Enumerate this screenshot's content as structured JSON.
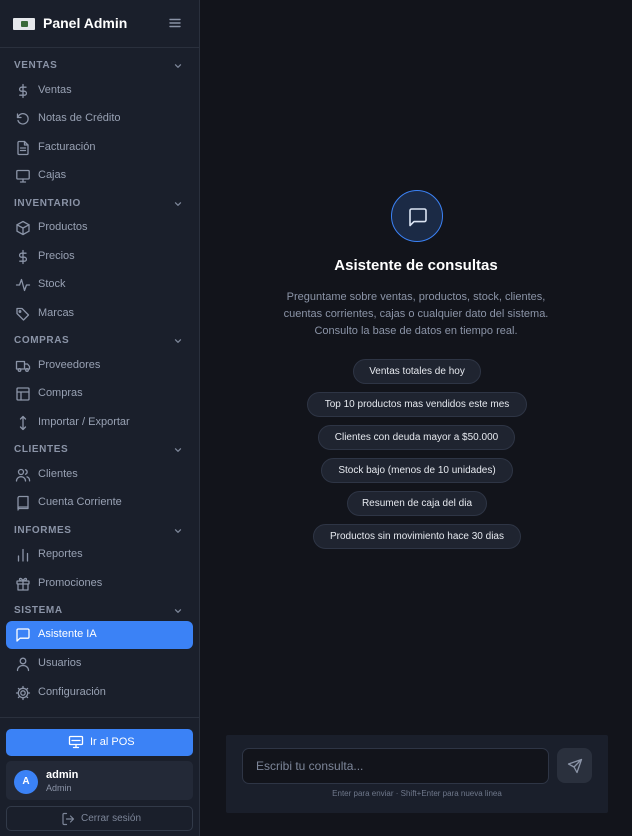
{
  "app": {
    "title": "Panel Admin"
  },
  "sidebar": {
    "sections": [
      {
        "title": "VENTAS",
        "items": [
          {
            "label": "Ventas",
            "icon": "dollar-icon"
          },
          {
            "label": "Notas de Crédito",
            "icon": "rotate-ccw-icon"
          },
          {
            "label": "Facturación",
            "icon": "file-text-icon"
          },
          {
            "label": "Cajas",
            "icon": "monitor-icon"
          }
        ]
      },
      {
        "title": "INVENTARIO",
        "items": [
          {
            "label": "Productos",
            "icon": "box-icon"
          },
          {
            "label": "Precios",
            "icon": "dollar-icon"
          },
          {
            "label": "Stock",
            "icon": "activity-icon"
          },
          {
            "label": "Marcas",
            "icon": "tag-icon"
          }
        ]
      },
      {
        "title": "COMPRAS",
        "items": [
          {
            "label": "Proveedores",
            "icon": "truck-icon"
          },
          {
            "label": "Compras",
            "icon": "layout-icon"
          },
          {
            "label": "Importar / Exportar",
            "icon": "arrows-vertical-icon"
          }
        ]
      },
      {
        "title": "CLIENTES",
        "items": [
          {
            "label": "Clientes",
            "icon": "users-icon"
          },
          {
            "label": "Cuenta Corriente",
            "icon": "book-icon"
          }
        ]
      },
      {
        "title": "INFORMES",
        "items": [
          {
            "label": "Reportes",
            "icon": "bar-chart-icon"
          },
          {
            "label": "Promociones",
            "icon": "gift-icon"
          }
        ]
      },
      {
        "title": "SISTEMA",
        "items": [
          {
            "label": "Asistente IA",
            "icon": "message-square-icon",
            "active": true
          },
          {
            "label": "Usuarios",
            "icon": "user-icon"
          },
          {
            "label": "Configuración",
            "icon": "settings-icon"
          }
        ]
      }
    ],
    "pos_button": "Ir al POS",
    "user": {
      "initial": "A",
      "name": "admin",
      "role": "Admin"
    },
    "logout": "Cerrar sesión"
  },
  "main": {
    "title": "Asistente de consultas",
    "description": "Preguntame sobre ventas, productos, stock, clientes, cuentas corrientes, cajas o cualquier dato del sistema. Consulto la base de datos en tiempo real.",
    "suggestions": [
      "Ventas totales de hoy",
      "Top 10 productos mas vendidos este mes",
      "Clientes con deuda mayor a $50.000",
      "Stock bajo (menos de 10 unidades)",
      "Resumen de caja del dia",
      "Productos sin movimiento hace 30 dias"
    ],
    "composer": {
      "placeholder": "Escribi tu consulta...",
      "value": "",
      "hint": "Enter para enviar · Shift+Enter para nueva linea"
    }
  },
  "colors": {
    "accent": "#3b82f6",
    "sidebar_bg": "#1a1f2b",
    "main_bg": "#12141b"
  }
}
